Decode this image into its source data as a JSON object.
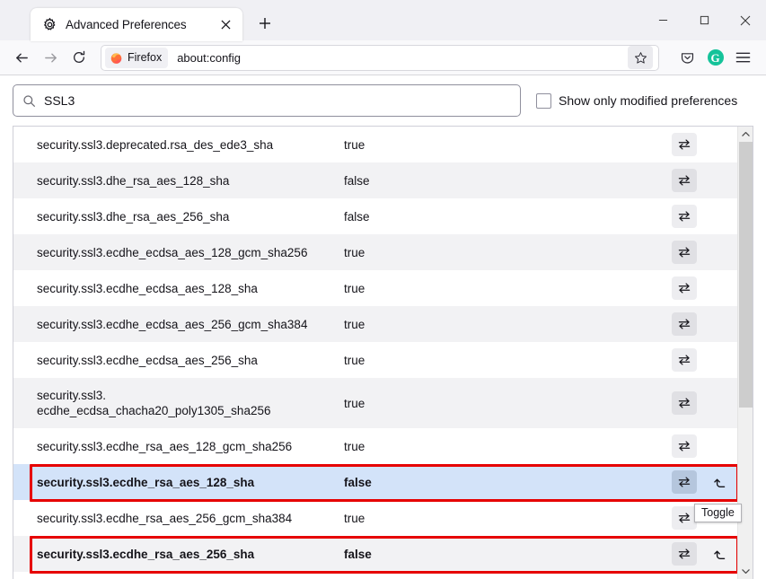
{
  "window": {
    "minimize_label": "Minimize",
    "maximize_label": "Maximize",
    "close_label": "Close"
  },
  "tabbar": {
    "tab_title": "Advanced Preferences",
    "tab_icon": "gear-icon",
    "close_tab_label": "Close tab",
    "new_tab_label": "New tab"
  },
  "toolbar": {
    "back_label": "Back",
    "forward_label": "Forward",
    "reload_label": "Reload",
    "brand_chip": "Firefox",
    "url": "about:config",
    "bookmark_label": "Bookmark this page",
    "pocket_label": "Save to Pocket",
    "extension_label": "G",
    "menu_label": "Open application menu"
  },
  "search": {
    "value": "SSL3",
    "placeholder": "Search preference name",
    "icon": "search-icon"
  },
  "filter": {
    "show_modified_label": "Show only modified preferences",
    "show_modified_checked": false
  },
  "tooltip": {
    "text": "Toggle"
  },
  "colors": {
    "selection": "#d3e3f9",
    "annotation": "#e60000",
    "stripe": "#f2f2f4",
    "accent_green": "#15c39a"
  },
  "actions": {
    "toggle_label": "Toggle",
    "reset_label": "Reset"
  },
  "preferences": [
    {
      "name": "security.ssl3.deprecated.rsa_des_ede3_sha",
      "value": "true",
      "modified": false,
      "selected": false,
      "has_reset": false,
      "wrapped": false
    },
    {
      "name": "security.ssl3.dhe_rsa_aes_128_sha",
      "value": "false",
      "modified": false,
      "selected": false,
      "has_reset": false,
      "wrapped": false
    },
    {
      "name": "security.ssl3.dhe_rsa_aes_256_sha",
      "value": "false",
      "modified": false,
      "selected": false,
      "has_reset": false,
      "wrapped": false
    },
    {
      "name": "security.ssl3.ecdhe_ecdsa_aes_128_gcm_sha256",
      "value": "true",
      "modified": false,
      "selected": false,
      "has_reset": false,
      "wrapped": false
    },
    {
      "name": "security.ssl3.ecdhe_ecdsa_aes_128_sha",
      "value": "true",
      "modified": false,
      "selected": false,
      "has_reset": false,
      "wrapped": false
    },
    {
      "name": "security.ssl3.ecdhe_ecdsa_aes_256_gcm_sha384",
      "value": "true",
      "modified": false,
      "selected": false,
      "has_reset": false,
      "wrapped": false
    },
    {
      "name": "security.ssl3.ecdhe_ecdsa_aes_256_sha",
      "value": "true",
      "modified": false,
      "selected": false,
      "has_reset": false,
      "wrapped": false
    },
    {
      "name": "security.ssl3.\necdhe_ecdsa_chacha20_poly1305_sha256",
      "value": "true",
      "modified": false,
      "selected": false,
      "has_reset": false,
      "wrapped": true
    },
    {
      "name": "security.ssl3.ecdhe_rsa_aes_128_gcm_sha256",
      "value": "true",
      "modified": false,
      "selected": false,
      "has_reset": false,
      "wrapped": false
    },
    {
      "name": "security.ssl3.ecdhe_rsa_aes_128_sha",
      "value": "false",
      "modified": true,
      "selected": true,
      "has_reset": true,
      "wrapped": false
    },
    {
      "name": "security.ssl3.ecdhe_rsa_aes_256_gcm_sha384",
      "value": "true",
      "modified": false,
      "selected": false,
      "has_reset": false,
      "wrapped": false
    },
    {
      "name": "security.ssl3.ecdhe_rsa_aes_256_sha",
      "value": "false",
      "modified": true,
      "selected": false,
      "has_reset": true,
      "wrapped": false
    }
  ]
}
